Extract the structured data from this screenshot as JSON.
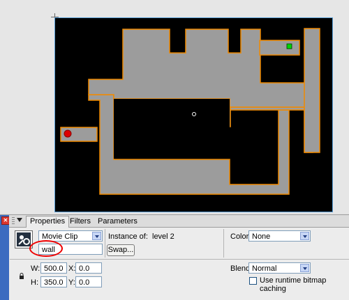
{
  "panel": {
    "close_glyph": "✕",
    "tabs": [
      {
        "label": "Properties"
      },
      {
        "label": "Filters"
      },
      {
        "label": "Parameters"
      }
    ]
  },
  "properties": {
    "symbol_type": "Movie Clip",
    "instance_name": "wall",
    "instance_of_label": "Instance of:",
    "instance_of_value": "level 2",
    "swap_label": "Swap...",
    "color_label": "Color:",
    "color_value": "None",
    "blend_label": "Blend:",
    "blend_value": "Normal",
    "cache_label": "Use runtime bitmap caching",
    "cache_checked": false,
    "w_label": "W:",
    "w_value": "500.0",
    "h_label": "H:",
    "h_value": "350.0",
    "x_label": "X:",
    "x_value": "0.0",
    "y_label": "Y:",
    "y_value": "0.0"
  },
  "stage": {
    "background_color": "#000000",
    "maze_fill": "#9c9c9c",
    "maze_outline": "#f08a00",
    "player_color": "#dd0000",
    "goal_color": "#00d400"
  },
  "icons": {
    "movie_clip": "movie-clip-symbol-icon",
    "lock": "lock-icon"
  }
}
